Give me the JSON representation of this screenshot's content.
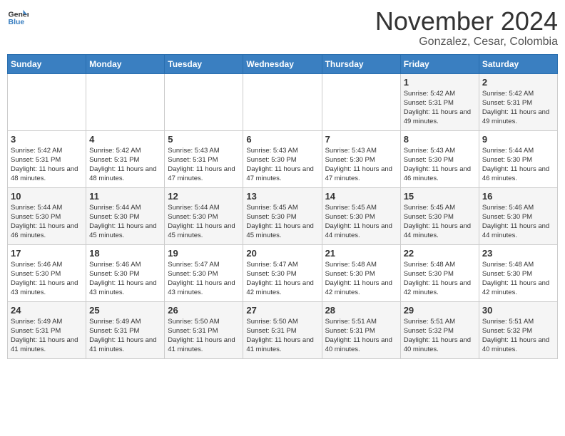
{
  "header": {
    "logo_line1": "General",
    "logo_line2": "Blue",
    "month_title": "November 2024",
    "location": "Gonzalez, Cesar, Colombia"
  },
  "days_of_week": [
    "Sunday",
    "Monday",
    "Tuesday",
    "Wednesday",
    "Thursday",
    "Friday",
    "Saturday"
  ],
  "weeks": [
    [
      {
        "day": "",
        "info": ""
      },
      {
        "day": "",
        "info": ""
      },
      {
        "day": "",
        "info": ""
      },
      {
        "day": "",
        "info": ""
      },
      {
        "day": "",
        "info": ""
      },
      {
        "day": "1",
        "info": "Sunrise: 5:42 AM\nSunset: 5:31 PM\nDaylight: 11 hours and 49 minutes."
      },
      {
        "day": "2",
        "info": "Sunrise: 5:42 AM\nSunset: 5:31 PM\nDaylight: 11 hours and 49 minutes."
      }
    ],
    [
      {
        "day": "3",
        "info": "Sunrise: 5:42 AM\nSunset: 5:31 PM\nDaylight: 11 hours and 48 minutes."
      },
      {
        "day": "4",
        "info": "Sunrise: 5:42 AM\nSunset: 5:31 PM\nDaylight: 11 hours and 48 minutes."
      },
      {
        "day": "5",
        "info": "Sunrise: 5:43 AM\nSunset: 5:31 PM\nDaylight: 11 hours and 47 minutes."
      },
      {
        "day": "6",
        "info": "Sunrise: 5:43 AM\nSunset: 5:30 PM\nDaylight: 11 hours and 47 minutes."
      },
      {
        "day": "7",
        "info": "Sunrise: 5:43 AM\nSunset: 5:30 PM\nDaylight: 11 hours and 47 minutes."
      },
      {
        "day": "8",
        "info": "Sunrise: 5:43 AM\nSunset: 5:30 PM\nDaylight: 11 hours and 46 minutes."
      },
      {
        "day": "9",
        "info": "Sunrise: 5:44 AM\nSunset: 5:30 PM\nDaylight: 11 hours and 46 minutes."
      }
    ],
    [
      {
        "day": "10",
        "info": "Sunrise: 5:44 AM\nSunset: 5:30 PM\nDaylight: 11 hours and 46 minutes."
      },
      {
        "day": "11",
        "info": "Sunrise: 5:44 AM\nSunset: 5:30 PM\nDaylight: 11 hours and 45 minutes."
      },
      {
        "day": "12",
        "info": "Sunrise: 5:44 AM\nSunset: 5:30 PM\nDaylight: 11 hours and 45 minutes."
      },
      {
        "day": "13",
        "info": "Sunrise: 5:45 AM\nSunset: 5:30 PM\nDaylight: 11 hours and 45 minutes."
      },
      {
        "day": "14",
        "info": "Sunrise: 5:45 AM\nSunset: 5:30 PM\nDaylight: 11 hours and 44 minutes."
      },
      {
        "day": "15",
        "info": "Sunrise: 5:45 AM\nSunset: 5:30 PM\nDaylight: 11 hours and 44 minutes."
      },
      {
        "day": "16",
        "info": "Sunrise: 5:46 AM\nSunset: 5:30 PM\nDaylight: 11 hours and 44 minutes."
      }
    ],
    [
      {
        "day": "17",
        "info": "Sunrise: 5:46 AM\nSunset: 5:30 PM\nDaylight: 11 hours and 43 minutes."
      },
      {
        "day": "18",
        "info": "Sunrise: 5:46 AM\nSunset: 5:30 PM\nDaylight: 11 hours and 43 minutes."
      },
      {
        "day": "19",
        "info": "Sunrise: 5:47 AM\nSunset: 5:30 PM\nDaylight: 11 hours and 43 minutes."
      },
      {
        "day": "20",
        "info": "Sunrise: 5:47 AM\nSunset: 5:30 PM\nDaylight: 11 hours and 42 minutes."
      },
      {
        "day": "21",
        "info": "Sunrise: 5:48 AM\nSunset: 5:30 PM\nDaylight: 11 hours and 42 minutes."
      },
      {
        "day": "22",
        "info": "Sunrise: 5:48 AM\nSunset: 5:30 PM\nDaylight: 11 hours and 42 minutes."
      },
      {
        "day": "23",
        "info": "Sunrise: 5:48 AM\nSunset: 5:30 PM\nDaylight: 11 hours and 42 minutes."
      }
    ],
    [
      {
        "day": "24",
        "info": "Sunrise: 5:49 AM\nSunset: 5:31 PM\nDaylight: 11 hours and 41 minutes."
      },
      {
        "day": "25",
        "info": "Sunrise: 5:49 AM\nSunset: 5:31 PM\nDaylight: 11 hours and 41 minutes."
      },
      {
        "day": "26",
        "info": "Sunrise: 5:50 AM\nSunset: 5:31 PM\nDaylight: 11 hours and 41 minutes."
      },
      {
        "day": "27",
        "info": "Sunrise: 5:50 AM\nSunset: 5:31 PM\nDaylight: 11 hours and 41 minutes."
      },
      {
        "day": "28",
        "info": "Sunrise: 5:51 AM\nSunset: 5:31 PM\nDaylight: 11 hours and 40 minutes."
      },
      {
        "day": "29",
        "info": "Sunrise: 5:51 AM\nSunset: 5:32 PM\nDaylight: 11 hours and 40 minutes."
      },
      {
        "day": "30",
        "info": "Sunrise: 5:51 AM\nSunset: 5:32 PM\nDaylight: 11 hours and 40 minutes."
      }
    ]
  ]
}
